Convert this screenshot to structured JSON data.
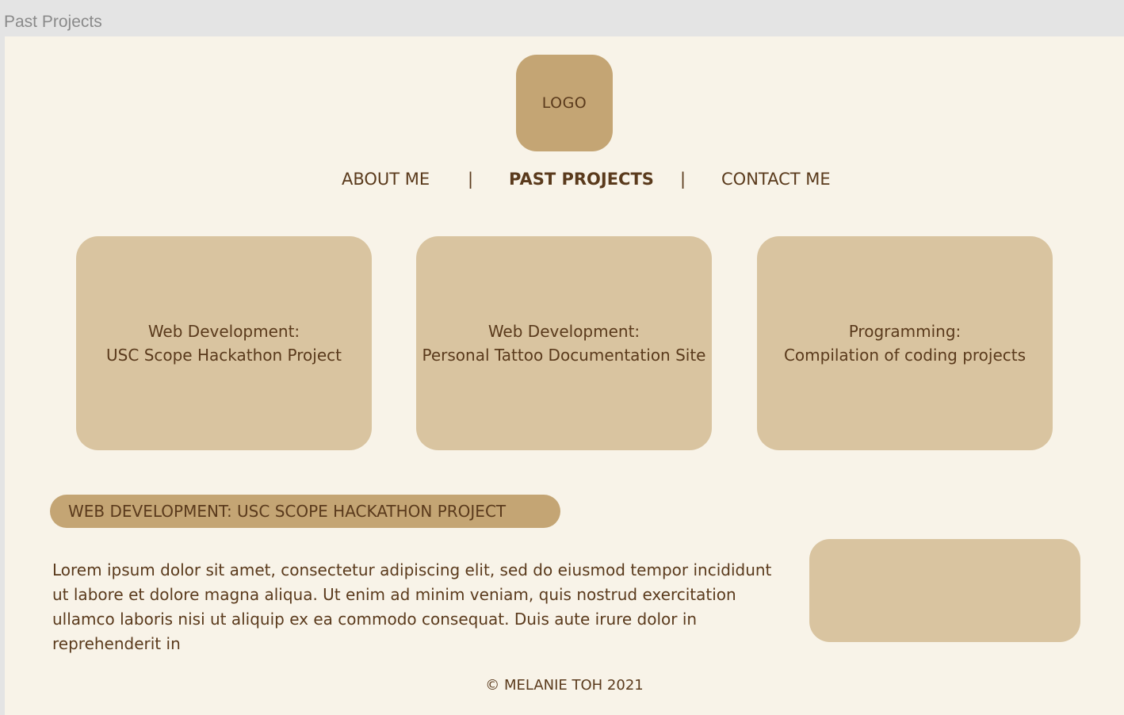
{
  "frame": {
    "title": "Past Projects"
  },
  "logo": {
    "label": "LOGO"
  },
  "nav": {
    "items": [
      "ABOUT ME",
      "PAST PROJECTS",
      "CONTACT ME"
    ],
    "separator": "|"
  },
  "cards": [
    {
      "category": "Web Development:",
      "title": "USC Scope Hackathon Project"
    },
    {
      "category": "Web Development:",
      "title": "Personal Tattoo Documentation Site"
    },
    {
      "category": "Programming:",
      "title": "Compilation of coding projects"
    }
  ],
  "section": {
    "heading": "WEB DEVELOPMENT: USC SCOPE HACKATHON PROJECT",
    "body": "Lorem ipsum dolor sit amet, consectetur adipiscing elit, sed do eiusmod tempor incididunt ut labore et dolore magna aliqua. Ut enim ad minim veniam, quis nostrud exercitation ullamco laboris nisi ut aliquip ex ea commodo consequat. Duis aute irure dolor in reprehenderit in"
  },
  "footer": {
    "text": "© MELANIE TOH 2021"
  },
  "colors": {
    "background": "#f8f3e8",
    "accent": "#c4a574",
    "card": "#d9c4a0",
    "text": "#5a3a1c"
  }
}
